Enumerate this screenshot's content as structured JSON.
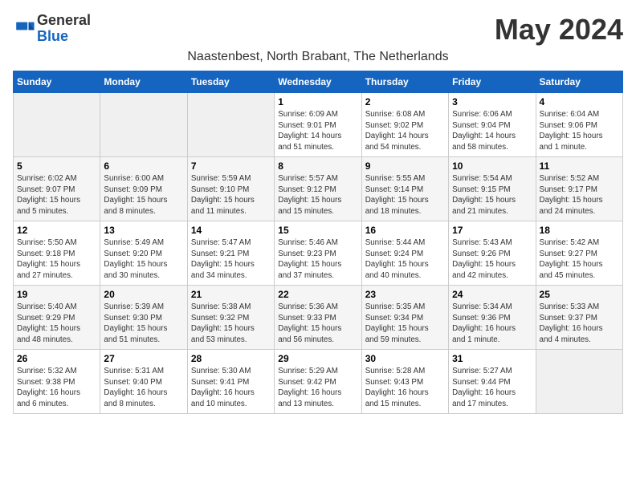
{
  "logo": {
    "general": "General",
    "blue": "Blue"
  },
  "title": "May 2024",
  "subtitle": "Naastenbest, North Brabant, The Netherlands",
  "days_of_week": [
    "Sunday",
    "Monday",
    "Tuesday",
    "Wednesday",
    "Thursday",
    "Friday",
    "Saturday"
  ],
  "weeks": [
    [
      {
        "day": "",
        "info": ""
      },
      {
        "day": "",
        "info": ""
      },
      {
        "day": "",
        "info": ""
      },
      {
        "day": "1",
        "info": "Sunrise: 6:09 AM\nSunset: 9:01 PM\nDaylight: 14 hours\nand 51 minutes."
      },
      {
        "day": "2",
        "info": "Sunrise: 6:08 AM\nSunset: 9:02 PM\nDaylight: 14 hours\nand 54 minutes."
      },
      {
        "day": "3",
        "info": "Sunrise: 6:06 AM\nSunset: 9:04 PM\nDaylight: 14 hours\nand 58 minutes."
      },
      {
        "day": "4",
        "info": "Sunrise: 6:04 AM\nSunset: 9:06 PM\nDaylight: 15 hours\nand 1 minute."
      }
    ],
    [
      {
        "day": "5",
        "info": "Sunrise: 6:02 AM\nSunset: 9:07 PM\nDaylight: 15 hours\nand 5 minutes."
      },
      {
        "day": "6",
        "info": "Sunrise: 6:00 AM\nSunset: 9:09 PM\nDaylight: 15 hours\nand 8 minutes."
      },
      {
        "day": "7",
        "info": "Sunrise: 5:59 AM\nSunset: 9:10 PM\nDaylight: 15 hours\nand 11 minutes."
      },
      {
        "day": "8",
        "info": "Sunrise: 5:57 AM\nSunset: 9:12 PM\nDaylight: 15 hours\nand 15 minutes."
      },
      {
        "day": "9",
        "info": "Sunrise: 5:55 AM\nSunset: 9:14 PM\nDaylight: 15 hours\nand 18 minutes."
      },
      {
        "day": "10",
        "info": "Sunrise: 5:54 AM\nSunset: 9:15 PM\nDaylight: 15 hours\nand 21 minutes."
      },
      {
        "day": "11",
        "info": "Sunrise: 5:52 AM\nSunset: 9:17 PM\nDaylight: 15 hours\nand 24 minutes."
      }
    ],
    [
      {
        "day": "12",
        "info": "Sunrise: 5:50 AM\nSunset: 9:18 PM\nDaylight: 15 hours\nand 27 minutes."
      },
      {
        "day": "13",
        "info": "Sunrise: 5:49 AM\nSunset: 9:20 PM\nDaylight: 15 hours\nand 30 minutes."
      },
      {
        "day": "14",
        "info": "Sunrise: 5:47 AM\nSunset: 9:21 PM\nDaylight: 15 hours\nand 34 minutes."
      },
      {
        "day": "15",
        "info": "Sunrise: 5:46 AM\nSunset: 9:23 PM\nDaylight: 15 hours\nand 37 minutes."
      },
      {
        "day": "16",
        "info": "Sunrise: 5:44 AM\nSunset: 9:24 PM\nDaylight: 15 hours\nand 40 minutes."
      },
      {
        "day": "17",
        "info": "Sunrise: 5:43 AM\nSunset: 9:26 PM\nDaylight: 15 hours\nand 42 minutes."
      },
      {
        "day": "18",
        "info": "Sunrise: 5:42 AM\nSunset: 9:27 PM\nDaylight: 15 hours\nand 45 minutes."
      }
    ],
    [
      {
        "day": "19",
        "info": "Sunrise: 5:40 AM\nSunset: 9:29 PM\nDaylight: 15 hours\nand 48 minutes."
      },
      {
        "day": "20",
        "info": "Sunrise: 5:39 AM\nSunset: 9:30 PM\nDaylight: 15 hours\nand 51 minutes."
      },
      {
        "day": "21",
        "info": "Sunrise: 5:38 AM\nSunset: 9:32 PM\nDaylight: 15 hours\nand 53 minutes."
      },
      {
        "day": "22",
        "info": "Sunrise: 5:36 AM\nSunset: 9:33 PM\nDaylight: 15 hours\nand 56 minutes."
      },
      {
        "day": "23",
        "info": "Sunrise: 5:35 AM\nSunset: 9:34 PM\nDaylight: 15 hours\nand 59 minutes."
      },
      {
        "day": "24",
        "info": "Sunrise: 5:34 AM\nSunset: 9:36 PM\nDaylight: 16 hours\nand 1 minute."
      },
      {
        "day": "25",
        "info": "Sunrise: 5:33 AM\nSunset: 9:37 PM\nDaylight: 16 hours\nand 4 minutes."
      }
    ],
    [
      {
        "day": "26",
        "info": "Sunrise: 5:32 AM\nSunset: 9:38 PM\nDaylight: 16 hours\nand 6 minutes."
      },
      {
        "day": "27",
        "info": "Sunrise: 5:31 AM\nSunset: 9:40 PM\nDaylight: 16 hours\nand 8 minutes."
      },
      {
        "day": "28",
        "info": "Sunrise: 5:30 AM\nSunset: 9:41 PM\nDaylight: 16 hours\nand 10 minutes."
      },
      {
        "day": "29",
        "info": "Sunrise: 5:29 AM\nSunset: 9:42 PM\nDaylight: 16 hours\nand 13 minutes."
      },
      {
        "day": "30",
        "info": "Sunrise: 5:28 AM\nSunset: 9:43 PM\nDaylight: 16 hours\nand 15 minutes."
      },
      {
        "day": "31",
        "info": "Sunrise: 5:27 AM\nSunset: 9:44 PM\nDaylight: 16 hours\nand 17 minutes."
      },
      {
        "day": "",
        "info": ""
      }
    ]
  ]
}
